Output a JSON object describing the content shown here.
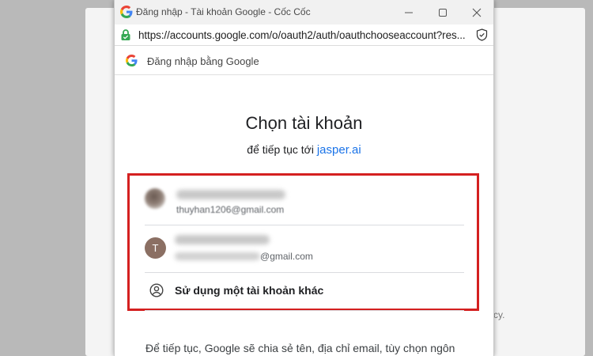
{
  "window": {
    "title": "Đăng nhập - Tài khoản Google - Cốc Cốc",
    "url": "https://accounts.google.com/o/oauth2/auth/oauthchooseaccount?res..."
  },
  "signin_header": {
    "text": "Đăng nhập bằng Google"
  },
  "chooser": {
    "heading": "Chọn tài khoản",
    "subheading_prefix": "để tiếp tục tới",
    "app_link": "jasper.ai"
  },
  "accounts": [
    {
      "email_visible": "thuyhan1206@gmail.com",
      "avatar": "photo"
    },
    {
      "avatar_letter": "T",
      "email_visible_suffix": "gmail.com",
      "avatar_color": "#8b6f63"
    }
  ],
  "other_account": {
    "label": "Sử dụng một tài khoản khác",
    "icon": "account-circle-icon"
  },
  "footer": {
    "text": "Để tiếp tục, Google sẽ chia sẻ tên, địa chỉ email, tùy chọn ngôn"
  },
  "background": {
    "right_fragment": "cy."
  },
  "colors": {
    "highlight": "#d42020",
    "link": "#1a73e8",
    "lock": "#34a853"
  }
}
